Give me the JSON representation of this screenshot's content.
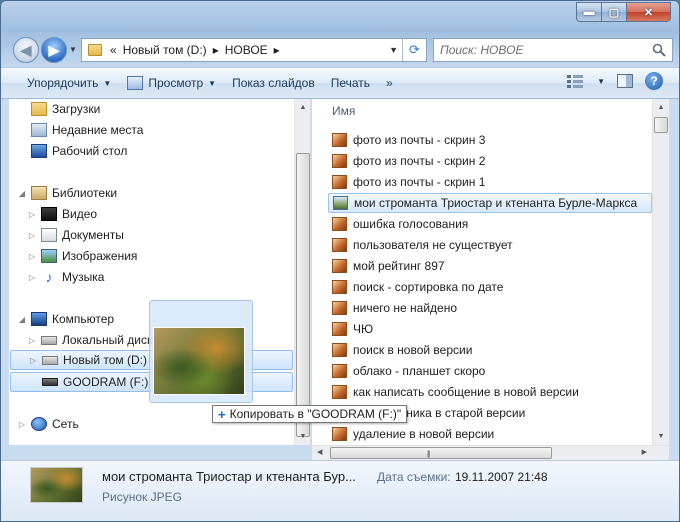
{
  "window": {
    "caption": {
      "minimize": "▬",
      "maximize": "▢",
      "close": "✕"
    }
  },
  "nav": {
    "back": "◀",
    "forward": "▶",
    "address": {
      "prefix": "«",
      "crumbs": [
        "Новый том (D:)",
        "НОВОЕ"
      ],
      "sep": "▸"
    },
    "search_placeholder": "Поиск: НОВОЕ"
  },
  "toolbar": {
    "organize": "Упорядочить",
    "view": "Просмотр",
    "slideshow": "Показ слайдов",
    "print": "Печать",
    "more": "»",
    "help": "?"
  },
  "sidebar": {
    "items": [
      {
        "label": "Загрузки",
        "icon": "downloads-folder-icon"
      },
      {
        "label": "Недавние места",
        "icon": "recent-places-icon"
      },
      {
        "label": "Рабочий стол",
        "icon": "desktop-icon"
      },
      {
        "label": "Библиотеки",
        "icon": "libraries-icon"
      },
      {
        "label": "Видео",
        "icon": "videos-icon"
      },
      {
        "label": "Документы",
        "icon": "documents-icon"
      },
      {
        "label": "Изображения",
        "icon": "pictures-icon"
      },
      {
        "label": "Музыка",
        "icon": "music-icon"
      },
      {
        "label": "Компьютер",
        "icon": "computer-icon"
      },
      {
        "label": "Локальный диск",
        "icon": "local-disk-icon"
      },
      {
        "label": "Новый том (D:)",
        "icon": "drive-icon"
      },
      {
        "label": "GOODRAM (F:)",
        "icon": "usb-drive-icon"
      },
      {
        "label": "Сеть",
        "icon": "network-icon"
      }
    ]
  },
  "files": {
    "column_name": "Имя",
    "rows": [
      "фото из почты - скрин 3",
      "фото из почты - скрин 2",
      "фото из почты - скрин 1",
      "мои строманта Триостар и ктенанта Бурле-Маркса",
      "ошибка голосования",
      "пользователя не существует",
      "мой рейтинг 897",
      "поиск - сортировка по дате",
      "ничего не найдено",
      "ЧЮ",
      "поиск в новой версии",
      "облако - планшет скоро",
      "как написать сообщение в новой версии",
      "рии у Ученика в старой версии",
      "удаление в новой версии"
    ],
    "selected_index": 3
  },
  "drag": {
    "tooltip": "Копировать в \"GOODRAM (F:)\""
  },
  "details": {
    "name": "мои строманта Триостар и ктенанта Бур...",
    "type": "Рисунок JPEG",
    "date_label": "Дата съемки:",
    "date_value": "19.11.2007 21:48"
  }
}
